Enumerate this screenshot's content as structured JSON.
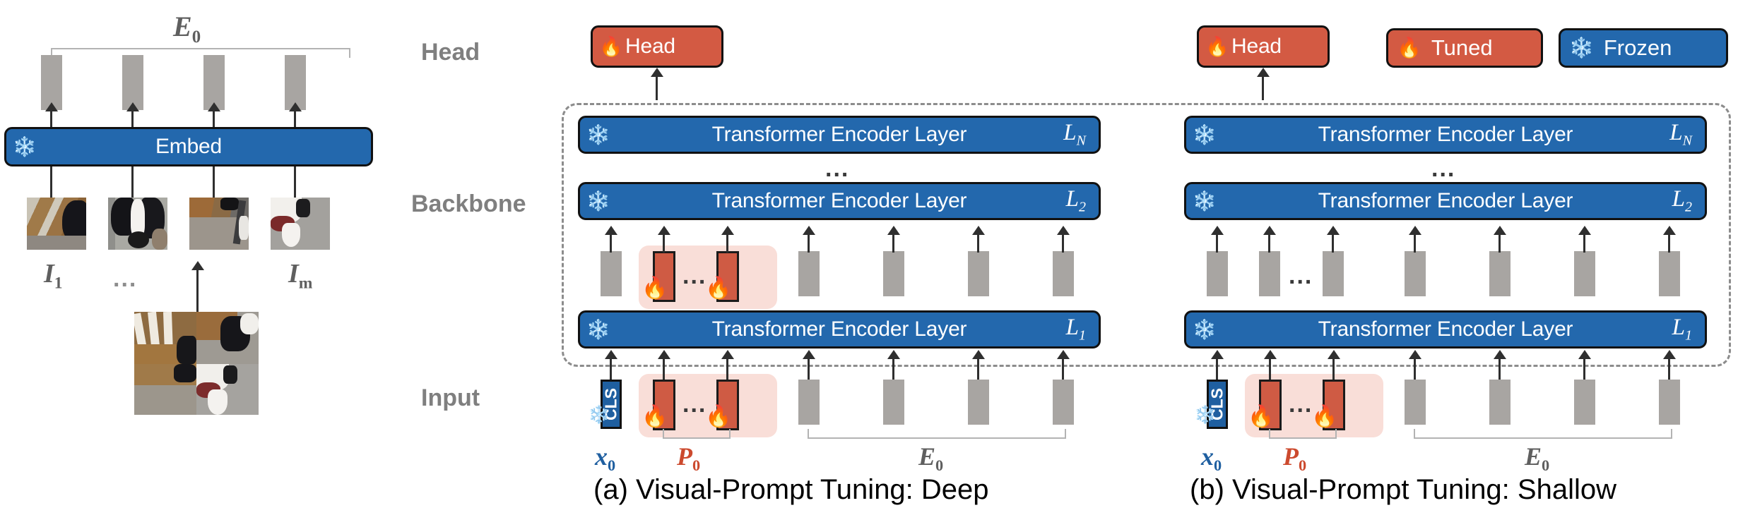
{
  "figure": {
    "row_labels": [
      "Head",
      "Backbone",
      "Input"
    ],
    "captions": {
      "left": "(a) Visual-Prompt Tuning:  Deep",
      "right": "(b) Visual-Prompt Tuning:  Shallow"
    }
  },
  "legend": {
    "items": [
      {
        "label": "Tuned",
        "icon": "fire-icon",
        "color": "#d35a43"
      },
      {
        "label": "Frozen",
        "icon": "snowflake-icon",
        "color": "#2368ad"
      }
    ]
  },
  "embed_panel": {
    "bracket_label": "E",
    "bracket_sub": "0",
    "embed_box": {
      "label": "Embed",
      "icon": "snowflake-icon",
      "color": "#2368ad"
    },
    "image_labels": [
      {
        "text": "I",
        "sub": "1"
      },
      {
        "text": "I",
        "sub": "m"
      }
    ],
    "ellipsis": "...",
    "num_tokens": 4,
    "num_patches": 4
  },
  "panel_a": {
    "head": {
      "label": "Head",
      "icon": "fire-icon",
      "color": "#d35a43"
    },
    "layers": [
      {
        "title": "Transformer Encoder Layer",
        "sub": "L",
        "subscript": "N",
        "icon": "snowflake-icon"
      },
      {
        "title": "Transformer Encoder Layer",
        "sub": "L",
        "subscript": "2",
        "icon": "snowflake-icon"
      },
      {
        "title": "Transformer Encoder Layer",
        "sub": "L",
        "subscript": "1",
        "icon": "snowflake-icon"
      }
    ],
    "layer_ellipsis": "...",
    "prompt_ellipsis": "...",
    "cls_label": "CLS",
    "labels": {
      "x": "x",
      "x_sub": "0",
      "p": "P",
      "p_sub": "0",
      "e": "E",
      "e_sub": "0"
    },
    "has_deep_prompts": true
  },
  "panel_b": {
    "head": {
      "label": "Head",
      "icon": "fire-icon",
      "color": "#d35a43"
    },
    "layers": [
      {
        "title": "Transformer Encoder Layer",
        "sub": "L",
        "subscript": "N",
        "icon": "snowflake-icon"
      },
      {
        "title": "Transformer Encoder Layer",
        "sub": "L",
        "subscript": "2",
        "icon": "snowflake-icon"
      },
      {
        "title": "Transformer Encoder Layer",
        "sub": "L",
        "subscript": "1",
        "icon": "snowflake-icon"
      }
    ],
    "layer_ellipsis": "...",
    "prompt_ellipsis": "...",
    "token_ellipsis": "...",
    "cls_label": "CLS",
    "labels": {
      "x": "x",
      "x_sub": "0",
      "p": "P",
      "p_sub": "0",
      "e": "E",
      "e_sub": "0"
    },
    "has_deep_prompts": false
  },
  "colors": {
    "tuned_red": "#d35a43",
    "frozen_blue": "#2368ad",
    "token_gray": "#a8a5a2",
    "prompt_pink_bg": "#f9ded8",
    "prompt_red": "#cf5b44",
    "label_gray": "#7f7f7f"
  },
  "icons": {
    "fire": "🔥",
    "snowflake": "❄"
  }
}
